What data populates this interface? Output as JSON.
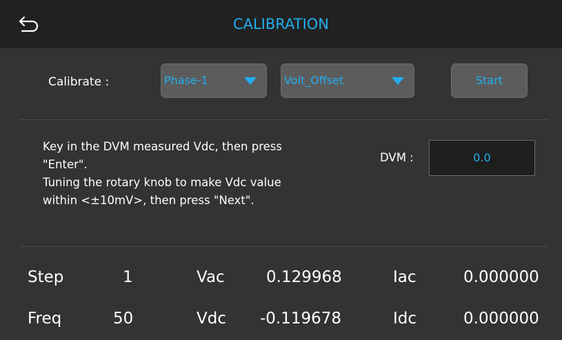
{
  "header": {
    "title": "CALIBRATION",
    "back_icon": "back-arrow-icon",
    "accent_color": "#22aef0"
  },
  "calibrate": {
    "label": "Calibrate :",
    "phase_select": {
      "value": "Phase-1"
    },
    "mode_select": {
      "value": "Volt_Offset"
    },
    "start_label": "Start"
  },
  "instructions": {
    "line1": "Key in the DVM measured Vdc, then press",
    "line2": "\"Enter\".",
    "line3": "Tuning the rotary knob to make Vdc value",
    "line4": "within <±10mV>, then press \"Next\"."
  },
  "dvm": {
    "label": "DVM :",
    "value": "0.0"
  },
  "readings": {
    "step_label": "Step",
    "step_value": "1",
    "vac_label": "Vac",
    "vac_value": "0.129968",
    "iac_label": "Iac",
    "iac_value": "0.000000",
    "freq_label": "Freq",
    "freq_value": "50",
    "vdc_label": "Vdc",
    "vdc_value": "-0.119678",
    "idc_label": "Idc",
    "idc_value": "0.000000"
  }
}
